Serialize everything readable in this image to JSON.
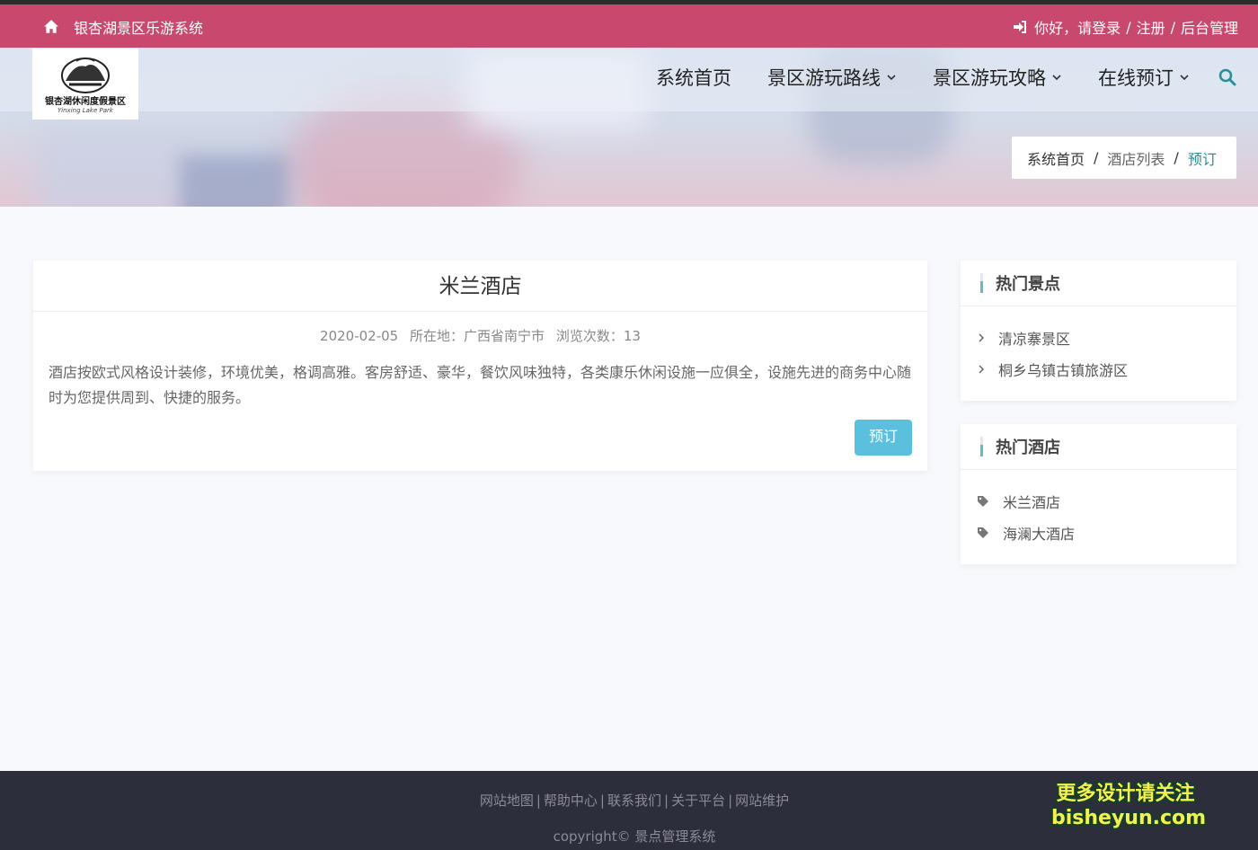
{
  "topbar": {
    "site_name": "银杏湖景区乐游系统",
    "greeting": "你好，请登录",
    "sep1": "/",
    "register": "注册",
    "sep2": "/",
    "admin": "后台管理"
  },
  "logo": {
    "title": "银杏湖休闲度假景区",
    "subtitle": "Yinxing Lake Park"
  },
  "nav": {
    "items": [
      {
        "label": "系统首页",
        "has_dropdown": false
      },
      {
        "label": "景区游玩路线",
        "has_dropdown": true
      },
      {
        "label": "景区游玩攻略",
        "has_dropdown": true
      },
      {
        "label": "在线预订",
        "has_dropdown": true
      }
    ],
    "search_icon": "search-icon"
  },
  "breadcrumb": {
    "home": "系统首页",
    "list": "酒店列表",
    "current": "预订",
    "sep": "/"
  },
  "detail": {
    "title": "米兰酒店",
    "date": "2020-02-05",
    "location_label": "所在地：",
    "location": "广西省南宁市",
    "views_label": "浏览次数：",
    "views": "13",
    "description": "酒店按欧式风格设计装修，环境优美，格调高雅。客房舒适、豪华，餐饮风味独特，各类康乐休闲设施一应俱全，设施先进的商务中心随时为您提供周到、快捷的服务。",
    "book_button": "预订"
  },
  "sidebar": {
    "hot_spots": {
      "title": "热门景点",
      "items": [
        "清凉寨景区",
        "桐乡乌镇古镇旅游区"
      ]
    },
    "hot_hotels": {
      "title": "热门酒店",
      "items": [
        "米兰酒店",
        "海澜大酒店"
      ]
    }
  },
  "footer": {
    "links": [
      "网站地图",
      "帮助中心",
      "联系我们",
      "关于平台",
      "网站维护"
    ],
    "copyright": "copyright© 景点管理系统"
  },
  "watermark": {
    "line1": "更多设计请关注",
    "line2": "bisheyun.com"
  },
  "colors": {
    "topbar": "#c8496d",
    "accent": "#2a8f96",
    "button": "#5bc0de",
    "footer": "#2d2e3c"
  }
}
